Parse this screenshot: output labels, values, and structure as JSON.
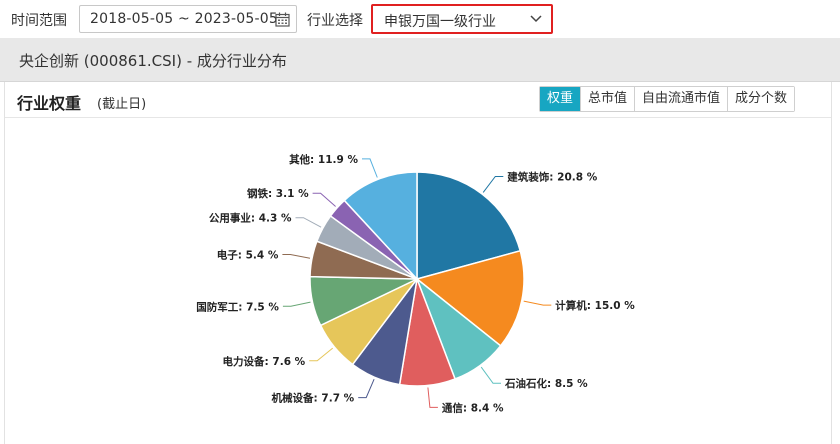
{
  "toolbar": {
    "time_range_label": "时间范围",
    "date_range": "2018-05-05 ~ 2023-05-05",
    "industry_label": "行业选择",
    "industry_value": "申银万国一级行业"
  },
  "panel": {
    "title": "央企创新 (000861.CSI) - 成分行业分布"
  },
  "card": {
    "title": "行业权重",
    "subtitle": "(截止日)",
    "tabs": [
      {
        "label": "权重",
        "active": true
      },
      {
        "label": "总市值",
        "active": false
      },
      {
        "label": "自由流通市值",
        "active": false
      },
      {
        "label": "成分个数",
        "active": false
      }
    ]
  },
  "chart_data": {
    "type": "pie",
    "unit": "%",
    "slices": [
      {
        "name": "建筑装饰",
        "value": 20.8,
        "color": "#2077a4",
        "label": "建筑装饰: 20.8 %"
      },
      {
        "name": "计算机",
        "value": 15.0,
        "color": "#f58a1f",
        "label": "计算机: 15.0 %"
      },
      {
        "name": "石油石化",
        "value": 8.5,
        "color": "#5fc1c0",
        "label": "石油石化: 8.5 %"
      },
      {
        "name": "通信",
        "value": 8.4,
        "color": "#e05e5e",
        "label": "通信: 8.4 %"
      },
      {
        "name": "机械设备",
        "value": 7.7,
        "color": "#4d5a8e",
        "label": "机械设备: 7.7 %"
      },
      {
        "name": "电力设备",
        "value": 7.6,
        "color": "#e6c65a",
        "label": "电力设备: 7.6 %"
      },
      {
        "name": "国防军工",
        "value": 7.5,
        "color": "#67a674",
        "label": "国防军工: 7.5 %"
      },
      {
        "name": "电子",
        "value": 5.4,
        "color": "#8f6b52",
        "label": "电子: 5.4 %"
      },
      {
        "name": "公用事业",
        "value": 4.3,
        "color": "#a2acb8",
        "label": "公用事业: 4.3 %"
      },
      {
        "name": "钢铁",
        "value": 3.1,
        "color": "#8a63b2",
        "label": "钢铁: 3.1 %"
      },
      {
        "name": "其他",
        "value": 11.9,
        "color": "#56b0df",
        "label": "其他: 11.9 %"
      }
    ]
  }
}
